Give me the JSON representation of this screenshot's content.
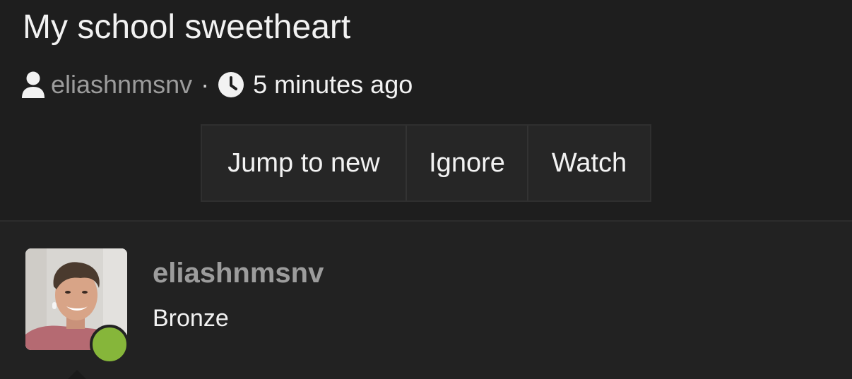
{
  "thread": {
    "title": "My school sweetheart",
    "author": "eliashnmsnv",
    "separator": "·",
    "time": "5 minutes ago",
    "icons": {
      "author": "user-icon",
      "time": "clock-icon"
    }
  },
  "actions": {
    "jump_label": "Jump to new",
    "ignore_label": "Ignore",
    "watch_label": "Watch"
  },
  "post": {
    "username": "eliashnmsnv",
    "rank": "Bronze",
    "status": "online",
    "status_color": "#86b63a"
  },
  "colors": {
    "background": "#1e1e1e",
    "post_background": "#222222",
    "muted_text": "#9c9c9c",
    "primary_text": "#f2f2f2"
  }
}
